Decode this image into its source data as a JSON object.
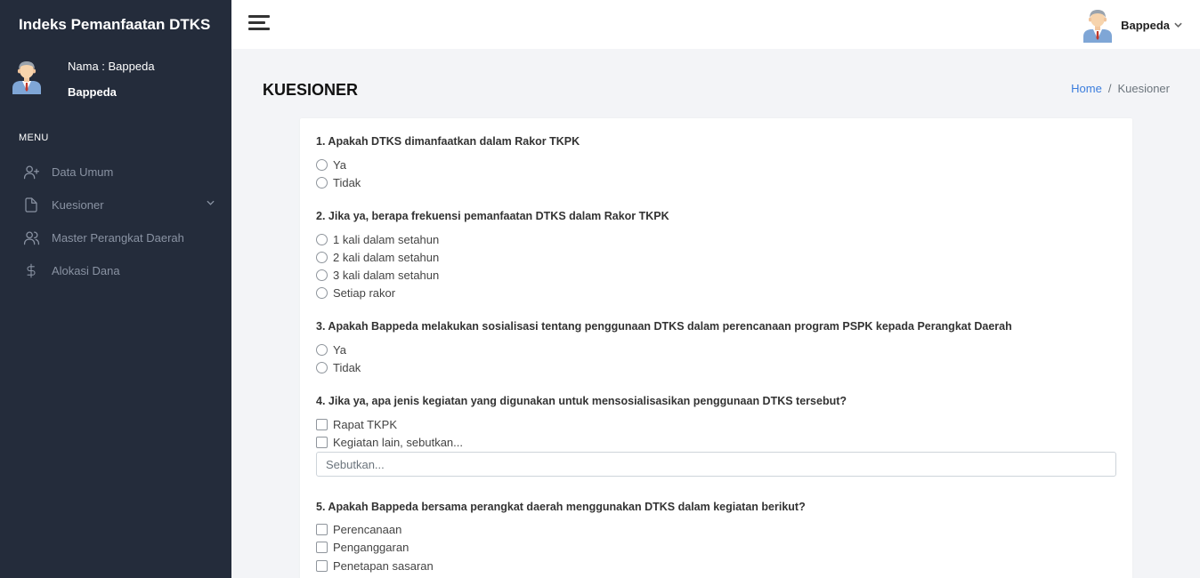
{
  "app": {
    "title": "Indeks Pemanfaatan DTKS"
  },
  "sidebar": {
    "user_name_line": "Nama : Bappeda",
    "user_role": "Bappeda",
    "menu_title": "MENU",
    "items": [
      {
        "label": "Data Umum",
        "icon": "user-plus-icon"
      },
      {
        "label": "Kuesioner",
        "icon": "file-icon"
      },
      {
        "label": "Master Perangkat Daerah",
        "icon": "users-icon"
      },
      {
        "label": "Alokasi Dana",
        "icon": "dollar-icon"
      }
    ]
  },
  "topbar": {
    "user": "Bappeda"
  },
  "page": {
    "title": "KUESIONER",
    "breadcrumb": {
      "home": "Home",
      "separator": "/",
      "current": "Kuesioner"
    }
  },
  "questions": [
    {
      "text": "1. Apakah DTKS dimanfaatkan dalam Rakor TKPK",
      "type": "radio",
      "options": [
        "Ya",
        "Tidak"
      ]
    },
    {
      "text": "2. Jika ya, berapa frekuensi pemanfaatan DTKS dalam Rakor TKPK",
      "type": "radio",
      "options": [
        "1 kali dalam setahun",
        "2 kali dalam setahun",
        "3 kali dalam setahun",
        "Setiap rakor"
      ]
    },
    {
      "text": "3. Apakah Bappeda melakukan sosialisasi tentang penggunaan DTKS dalam perencanaan program PSPK kepada Perangkat Daerah",
      "type": "radio",
      "options": [
        "Ya",
        "Tidak"
      ]
    },
    {
      "text": "4. Jika ya, apa jenis kegiatan yang digunakan untuk mensosialisasikan penggunaan DTKS tersebut?",
      "type": "checkbox",
      "options": [
        "Rapat TKPK",
        "Kegiatan lain, sebutkan..."
      ],
      "input_placeholder": "Sebutkan..."
    },
    {
      "text": "5. Apakah Bappeda bersama perangkat daerah menggunakan DTKS dalam kegiatan berikut?",
      "type": "checkbox",
      "options": [
        "Perencanaan",
        "Penganggaran",
        "Penetapan sasaran"
      ]
    }
  ],
  "colors": {
    "sidebar_bg": "#242c3b",
    "link": "#3b7ddd",
    "page_bg": "#f3f4f7"
  }
}
